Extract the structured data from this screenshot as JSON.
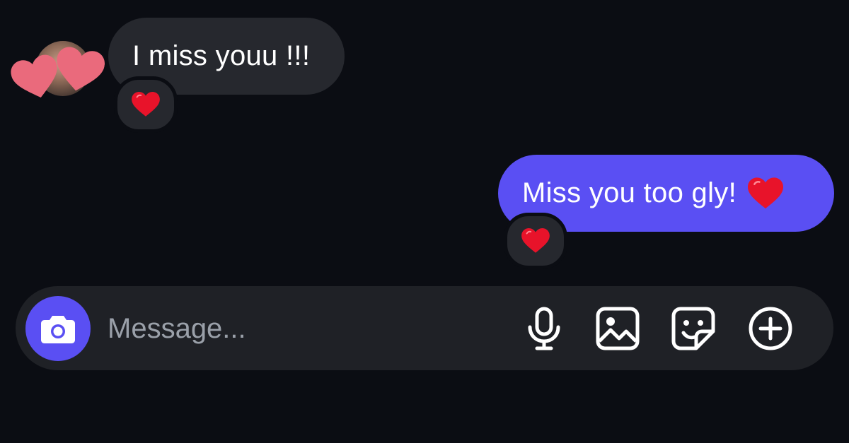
{
  "conversation": {
    "incoming": {
      "text": "I miss youu !!!",
      "reaction_icon": "red-heart-emoji"
    },
    "outgoing": {
      "text": "Miss you too gly!",
      "inline_emoji": "red-heart-emoji",
      "reaction_icon": "red-heart-emoji"
    }
  },
  "composer": {
    "placeholder": "Message...",
    "buttons": {
      "camera": "camera-icon",
      "mic": "microphone-icon",
      "gallery": "image-gallery-icon",
      "sticker": "sticker-icon",
      "more": "plus-circle-icon"
    }
  },
  "colors": {
    "background": "#0b0d13",
    "incoming_bubble": "#26282e",
    "outgoing_bubble": "#5a4ff3",
    "composer": "#1f2126",
    "accent": "#5a4ff3",
    "placeholder": "#9aa0a9",
    "heart": "#e8132a",
    "avatar_hearts": "#ea6a7c"
  }
}
